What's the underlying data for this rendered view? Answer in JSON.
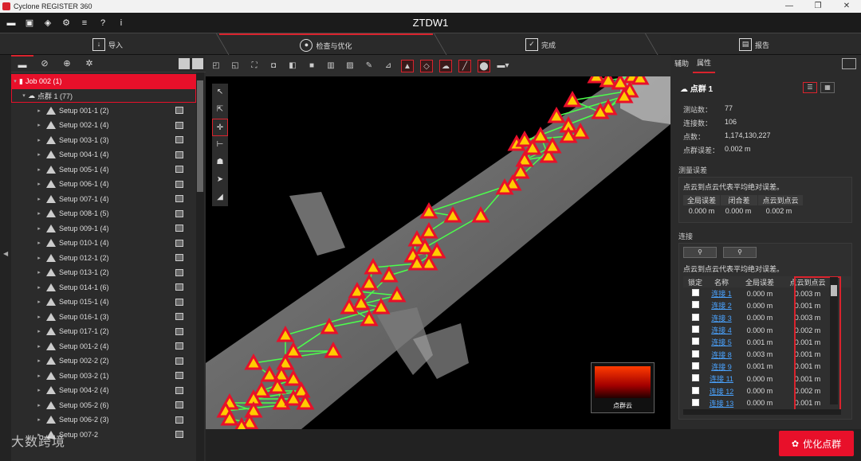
{
  "window": {
    "app_title": "Cyclone REGISTER 360",
    "minimize": "—",
    "maximize": "❐",
    "close": "✕"
  },
  "document": {
    "title": "ZTDW1"
  },
  "steps": [
    {
      "label": "导入"
    },
    {
      "label": "检查与优化"
    },
    {
      "label": "完成"
    },
    {
      "label": "报告"
    }
  ],
  "tree": {
    "job": "Job 002 (1)",
    "cloud": "点群 1 (77)",
    "setups": [
      "Setup 001-1 (2)",
      "Setup 002-1 (4)",
      "Setup 003-1 (3)",
      "Setup 004-1 (4)",
      "Setup 005-1 (4)",
      "Setup 006-1 (4)",
      "Setup 007-1 (4)",
      "Setup 008-1 (5)",
      "Setup 009-1 (4)",
      "Setup 010-1 (4)",
      "Setup 012-1 (2)",
      "Setup 013-1 (2)",
      "Setup 014-1 (6)",
      "Setup 015-1 (4)",
      "Setup 016-1 (3)",
      "Setup 017-1 (2)",
      "Setup 001-2 (4)",
      "Setup 002-2 (2)",
      "Setup 003-2 (1)",
      "Setup 004-2 (4)",
      "Setup 005-2 (6)",
      "Setup 006-2 (3)",
      "Setup 007-2"
    ]
  },
  "right": {
    "tabs": [
      "辅助",
      "属性"
    ],
    "cloud_title": "点群 1",
    "stats": [
      {
        "k": "测站数：",
        "v": "77"
      },
      {
        "k": "连接数：",
        "v": "106"
      },
      {
        "k": "点数：",
        "v": "1,174,130,227"
      },
      {
        "k": "点群误差：",
        "v": "0.002 m"
      }
    ],
    "measure_section": "测量误差",
    "measure_desc": "点云到点云代表平均绝对误差。",
    "err_headers": [
      "全局误差",
      "闭合差",
      "点云到点云"
    ],
    "err_values": [
      "0.000 m",
      "0.000 m",
      "0.002 m"
    ],
    "links_section": "连接",
    "links_desc": "点云到点云代表平均绝对误差。",
    "link_headers": [
      "锁定",
      "名称",
      "全局误差",
      "点云到点云"
    ],
    "links": [
      {
        "name": "连接 1",
        "global": "0.000 m",
        "c2c": "0.003 m"
      },
      {
        "name": "连接 2",
        "global": "0.000 m",
        "c2c": "0.001 m"
      },
      {
        "name": "连接 3",
        "global": "0.000 m",
        "c2c": "0.003 m"
      },
      {
        "name": "连接 4",
        "global": "0.000 m",
        "c2c": "0.002 m"
      },
      {
        "name": "连接 5",
        "global": "0.001 m",
        "c2c": "0.001 m"
      },
      {
        "name": "连接 8",
        "global": "0.003 m",
        "c2c": "0.001 m"
      },
      {
        "name": "连接 9",
        "global": "0.001 m",
        "c2c": "0.001 m"
      },
      {
        "name": "连接 11",
        "global": "0.000 m",
        "c2c": "0.001 m"
      },
      {
        "name": "连接 12",
        "global": "0.000 m",
        "c2c": "0.002 m"
      },
      {
        "name": "连接 13",
        "global": "0.000 m",
        "c2c": "0.001 m"
      }
    ]
  },
  "viewer": {
    "thumbnail_label": "点群云"
  },
  "actions": {
    "optimize": "优化点群"
  },
  "watermark": "大数跨境"
}
